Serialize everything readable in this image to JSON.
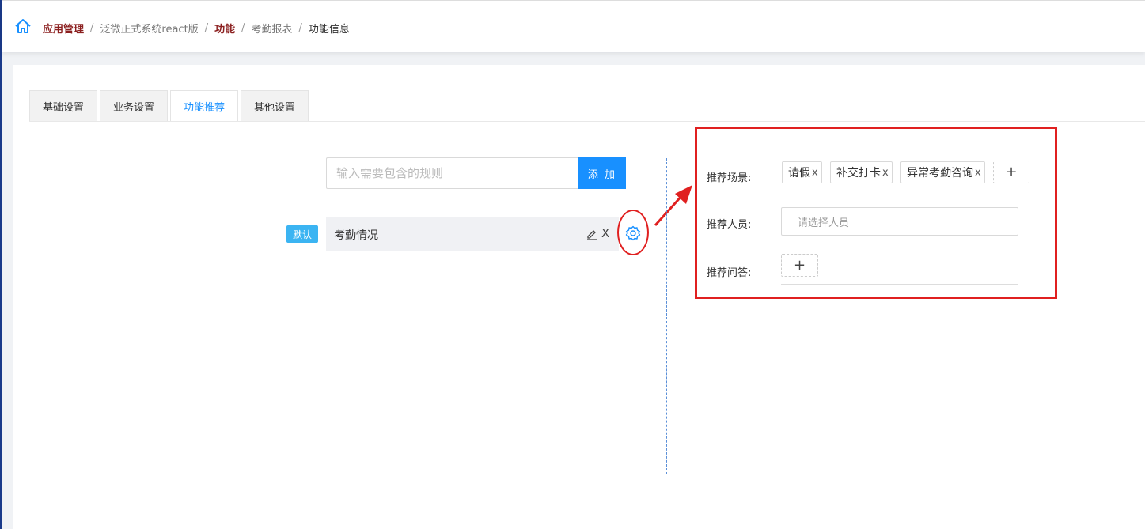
{
  "breadcrumb": {
    "items": [
      {
        "label": "应用管理"
      },
      {
        "label": "泛微正式系统react版"
      },
      {
        "label": "功能"
      },
      {
        "label": "考勤报表"
      },
      {
        "label": "功能信息"
      }
    ],
    "separator": "/"
  },
  "tabs": [
    {
      "label": "基础设置",
      "active": false
    },
    {
      "label": "业务设置",
      "active": false
    },
    {
      "label": "功能推荐",
      "active": true
    },
    {
      "label": "其他设置",
      "active": false
    }
  ],
  "rule_input": {
    "placeholder": "输入需要包含的规则",
    "value": ""
  },
  "add_button": {
    "label": "添 加"
  },
  "rule_item": {
    "badge": "默认",
    "name": "考勤情况",
    "delete": "X"
  },
  "panel": {
    "scene_label": "推荐场景:",
    "scene_tags": [
      {
        "label": "请假",
        "remove": "x"
      },
      {
        "label": "补交打卡",
        "remove": "x"
      },
      {
        "label": "异常考勤咨询",
        "remove": "x"
      }
    ],
    "add_symbol": "+",
    "person_label": "推荐人员:",
    "person_placeholder": "请选择人员",
    "qa_label": "推荐问答:"
  },
  "colors": {
    "accent": "#1890ff",
    "badge": "#3bb4f2",
    "highlight": "#e02020",
    "breadcrumb_bold": "#8b1f1f"
  },
  "icons": [
    "home-icon",
    "edit-icon",
    "gear-icon",
    "arrow-icon"
  ]
}
